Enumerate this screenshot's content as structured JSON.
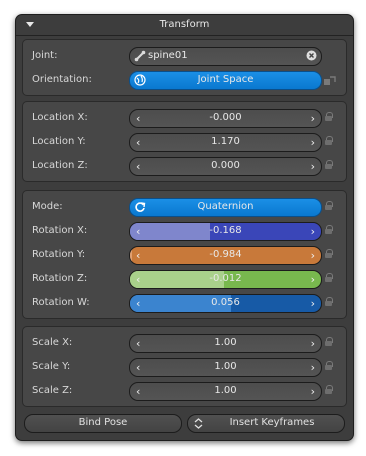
{
  "header": {
    "title": "Transform"
  },
  "joint": {
    "label": "Joint:",
    "value": "spine01"
  },
  "orientation": {
    "label": "Orientation:",
    "value": "Joint Space"
  },
  "location": [
    {
      "label": "Location X:",
      "value": "-0.000"
    },
    {
      "label": "Location Y:",
      "value": "1.170"
    },
    {
      "label": "Location Z:",
      "value": "0.000"
    }
  ],
  "mode": {
    "label": "Mode:",
    "value": "Quaternion"
  },
  "rotation": [
    {
      "label": "Rotation X:",
      "value": "-0.168",
      "fraction": 0.42,
      "fill": "#7f86cc",
      "base": "#3a46b8"
    },
    {
      "label": "Rotation Y:",
      "value": "-0.984",
      "fraction": 0.01,
      "fill": "#e0a072",
      "base": "#c8793a"
    },
    {
      "label": "Rotation Z:",
      "value": "-0.012",
      "fraction": 0.49,
      "fill": "#a9d18b",
      "base": "#78b84e"
    },
    {
      "label": "Rotation W:",
      "value": "0.056",
      "fraction": 0.53,
      "fill": "#3b84cf",
      "base": "#175aa6"
    }
  ],
  "scale": [
    {
      "label": "Scale X:",
      "value": "1.00"
    },
    {
      "label": "Scale Y:",
      "value": "1.00"
    },
    {
      "label": "Scale Z:",
      "value": "1.00"
    }
  ],
  "buttons": {
    "bind_pose": "Bind Pose",
    "insert_keyframes": "Insert Keyframes"
  },
  "icons": {
    "collapse": "triangle-down-icon",
    "joint": "bone-icon",
    "clear": "close-circle-icon",
    "orientation": "globe-icon",
    "mode": "refresh-icon",
    "lock": "lock-icon",
    "updown": "up-down-arrows-icon"
  }
}
